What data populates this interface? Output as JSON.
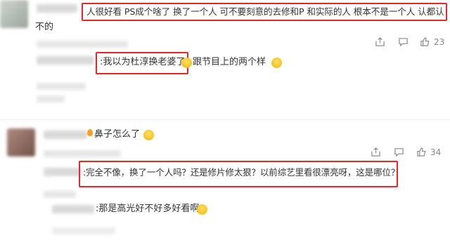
{
  "comments": [
    {
      "text_line1": "人很好看 PS成个啥了 换了一个人 可不要刻意的去修和P 和实际的人 根本不是一个人 认都认",
      "text_line2": "不的",
      "like_count": "23"
    },
    {
      "text_part1": ":我以为杜淳换老婆了",
      "text_part2": "跟节目上的两个样"
    },
    {
      "text": "鼻子怎么了",
      "like_count": "34"
    },
    {
      "text": ":完全不像，换了一个人吗？还是修片修太狠？以前综艺里看很漂亮呀，这是哪位？"
    },
    {
      "text": ":那是高光好不好多好看啊"
    }
  ],
  "icons": {
    "share": "share-icon",
    "comment": "comment-icon",
    "like": "thumbs-up-icon"
  },
  "colors": {
    "highlight": "#e8262a",
    "icon": "#8c8c8c"
  }
}
